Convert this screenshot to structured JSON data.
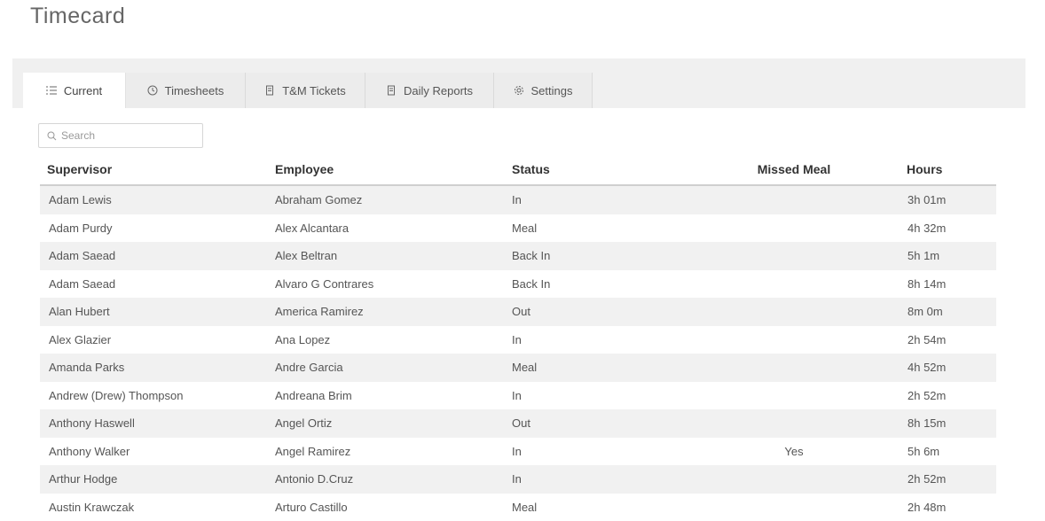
{
  "page": {
    "title": "Timecard"
  },
  "tabs": [
    {
      "label": "Current",
      "icon": "list-icon",
      "active": true
    },
    {
      "label": "Timesheets",
      "icon": "clock-icon",
      "active": false
    },
    {
      "label": "T&M Tickets",
      "icon": "document-icon",
      "active": false
    },
    {
      "label": "Daily Reports",
      "icon": "document-icon",
      "active": false
    },
    {
      "label": "Settings",
      "icon": "gear-icon",
      "active": false
    }
  ],
  "search": {
    "placeholder": "Search",
    "value": ""
  },
  "table": {
    "headers": [
      "Supervisor",
      "Employee",
      "Status",
      "Missed Meal",
      "Hours"
    ],
    "rows": [
      {
        "supervisor": "Adam Lewis",
        "employee": "Abraham Gomez",
        "status": "In",
        "missed_meal": "",
        "hours": "3h 01m"
      },
      {
        "supervisor": "Adam Purdy",
        "employee": "Alex Alcantara",
        "status": "Meal",
        "missed_meal": "",
        "hours": "4h 32m"
      },
      {
        "supervisor": "Adam Saead",
        "employee": "Alex Beltran",
        "status": "Back In",
        "missed_meal": "",
        "hours": "5h 1m"
      },
      {
        "supervisor": "Adam Saead",
        "employee": "Alvaro G Contrares",
        "status": "Back In",
        "missed_meal": "",
        "hours": "8h 14m"
      },
      {
        "supervisor": "Alan Hubert",
        "employee": "America Ramirez",
        "status": "Out",
        "missed_meal": "",
        "hours": "8m 0m"
      },
      {
        "supervisor": "Alex Glazier",
        "employee": "Ana Lopez",
        "status": "In",
        "missed_meal": "",
        "hours": "2h 54m"
      },
      {
        "supervisor": "Amanda Parks",
        "employee": "Andre Garcia",
        "status": "Meal",
        "missed_meal": "",
        "hours": "4h 52m"
      },
      {
        "supervisor": "Andrew (Drew) Thompson",
        "employee": "Andreana Brim",
        "status": "In",
        "missed_meal": "",
        "hours": "2h 52m"
      },
      {
        "supervisor": "Anthony Haswell",
        "employee": "Angel Ortiz",
        "status": "Out",
        "missed_meal": "",
        "hours": "8h 15m"
      },
      {
        "supervisor": "Anthony Walker",
        "employee": "Angel Ramirez",
        "status": "In",
        "missed_meal": "Yes",
        "hours": "5h 6m"
      },
      {
        "supervisor": "Arthur Hodge",
        "employee": "Antonio D.Cruz",
        "status": "In",
        "missed_meal": "",
        "hours": "2h 52m"
      },
      {
        "supervisor": "Austin Krawczak",
        "employee": "Arturo Castillo",
        "status": "Meal",
        "missed_meal": "",
        "hours": "2h 48m"
      }
    ]
  }
}
